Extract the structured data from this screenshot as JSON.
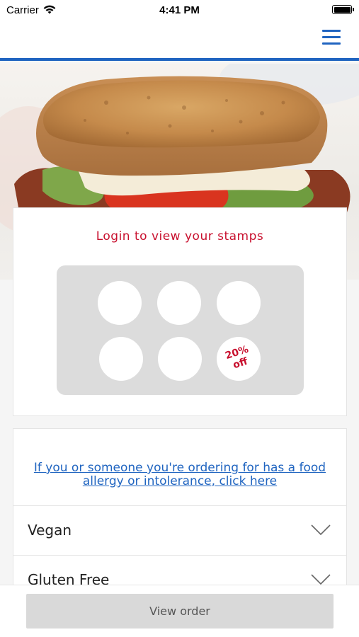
{
  "status_bar": {
    "carrier": "Carrier",
    "time": "4:41 PM"
  },
  "header": {
    "menu_icon": "hamburger-menu-icon",
    "accent_color": "#1f64c0"
  },
  "hero": {
    "image": "toasted-sandwich-photo"
  },
  "stamps": {
    "title": "Login to view your stamps",
    "stamp_count": 6,
    "reward_text_line1": "20%",
    "reward_text_line2": "off",
    "title_color": "#c8102e"
  },
  "allergy": {
    "link_text": "If you or someone you're ordering for has a food allergy or intolerance, click here",
    "filters": [
      {
        "label": "Vegan",
        "icon": "chevron-down-icon"
      },
      {
        "label": "Gluten Free",
        "icon": "chevron-down-icon"
      }
    ]
  },
  "footer": {
    "view_order_label": "View order"
  }
}
